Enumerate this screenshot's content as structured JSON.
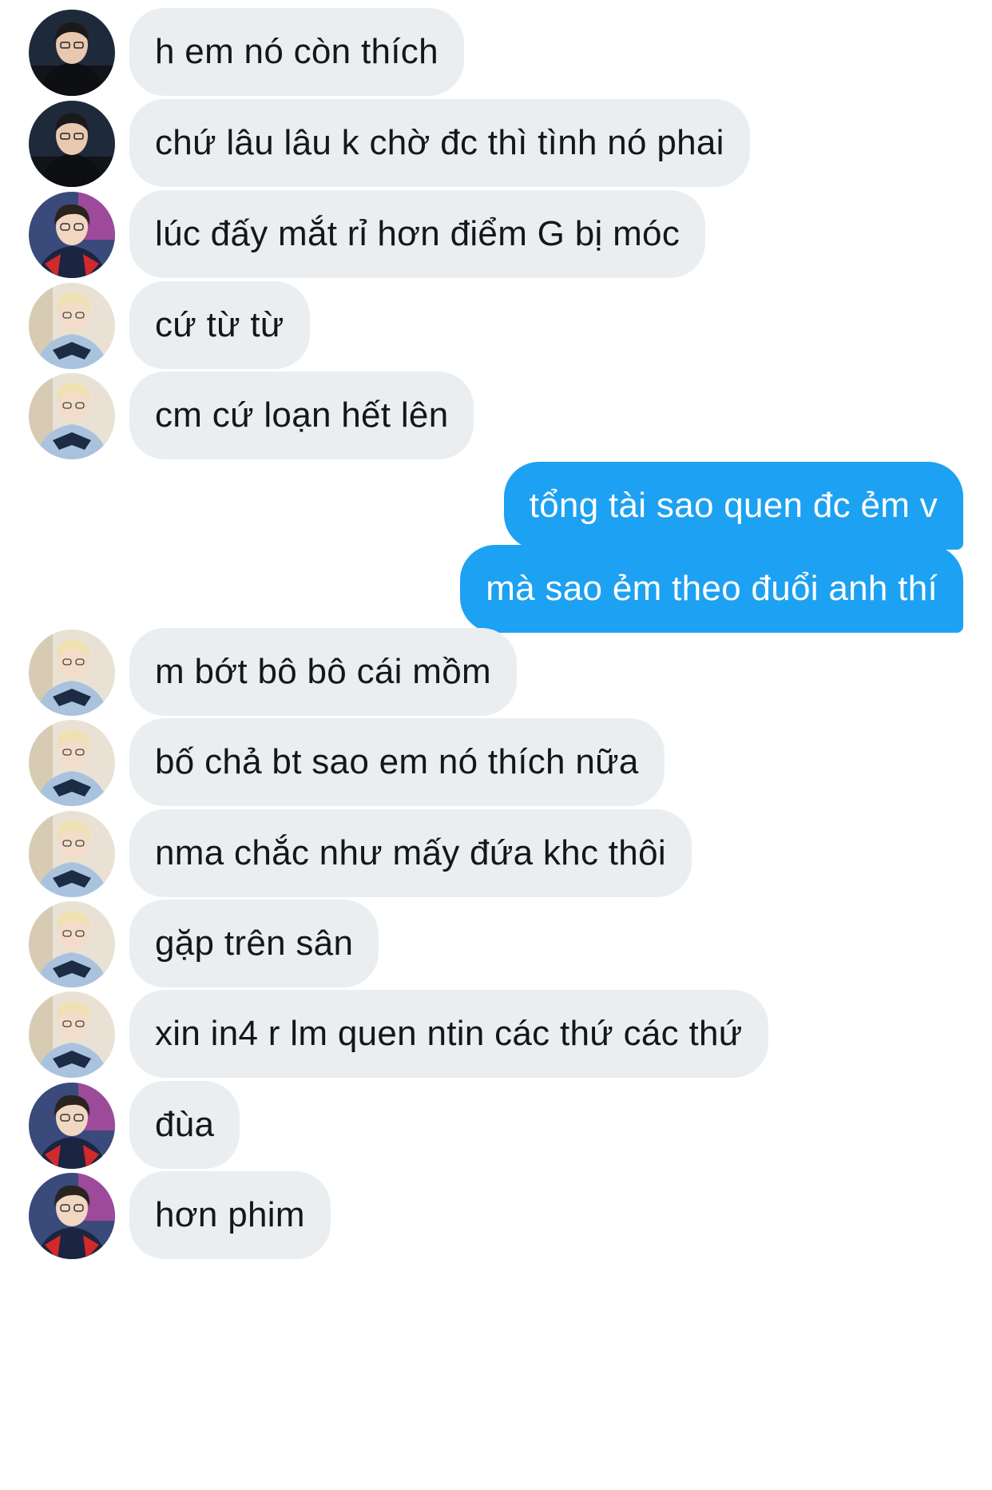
{
  "conversation": {
    "messages": [
      {
        "sender": "contact_a",
        "text": "h em nó còn thích"
      },
      {
        "sender": "contact_a",
        "text": "chứ lâu lâu k chờ đc thì tình nó phai"
      },
      {
        "sender": "contact_b",
        "text": "lúc đấy mắt rỉ hơn điểm G bị móc"
      },
      {
        "sender": "contact_c",
        "text": "cứ từ từ"
      },
      {
        "sender": "contact_c",
        "text": "cm cứ loạn hết lên"
      },
      {
        "sender": "self",
        "text": "tổng tài sao quen đc ẻm v"
      },
      {
        "sender": "self",
        "text": "mà sao ẻm theo đuổi anh thí"
      },
      {
        "sender": "contact_c",
        "text": "m bớt bô bô cái mồm"
      },
      {
        "sender": "contact_c",
        "text": "bố chả bt sao em nó thích nữa"
      },
      {
        "sender": "contact_c",
        "text": "nma chắc như mấy đứa khc thôi"
      },
      {
        "sender": "contact_c",
        "text": "gặp trên sân"
      },
      {
        "sender": "contact_c",
        "text": "xin in4 r lm quen ntin các thứ các thứ"
      },
      {
        "sender": "contact_b",
        "text": "đùa"
      },
      {
        "sender": "contact_b",
        "text": "hơn phim"
      }
    ]
  },
  "colors": {
    "incoming_bubble": "#ebeef0",
    "incoming_text": "#14171a",
    "outgoing_bubble": "#1da1f2",
    "outgoing_text": "#ffffff"
  },
  "icons": {
    "contact_a_avatar": "avatar-dark-hoodie-photo",
    "contact_b_avatar": "avatar-team-jersey-photo",
    "contact_c_avatar": "avatar-light-jersey-photo"
  }
}
